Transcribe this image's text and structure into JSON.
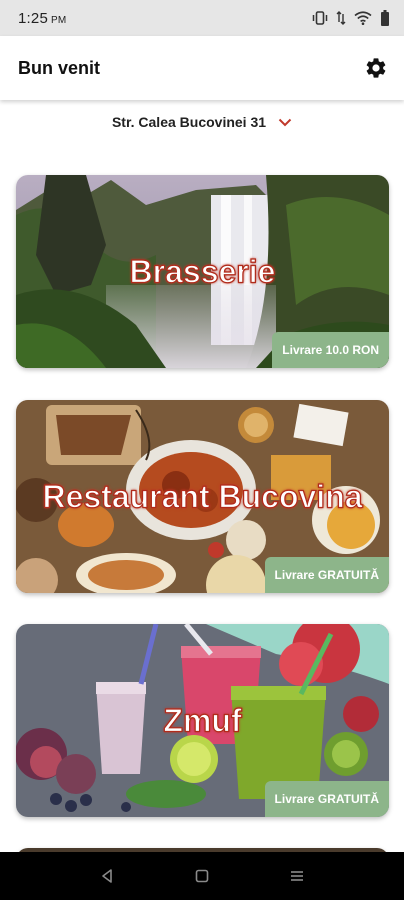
{
  "status_bar": {
    "time": "1:25",
    "ampm": "PM",
    "icons": [
      "vibrate-icon",
      "data-arrows-icon",
      "wifi-icon",
      "battery-icon"
    ]
  },
  "app_bar": {
    "title": "Bun venit",
    "settings_icon": "gear-icon"
  },
  "address": {
    "label": "Str. Calea Bucovinei 31",
    "icon": "chevron-down-icon",
    "accent": "#c0392b"
  },
  "restaurants": [
    {
      "name": "Brasserie",
      "delivery": "Livrare 10.0 RON"
    },
    {
      "name": "Restaurant Bucovina",
      "delivery": "Livrare GRATUITĂ"
    },
    {
      "name": "Zmuf",
      "delivery": "Livrare GRATUITĂ"
    }
  ],
  "colors": {
    "badge": "#8db58a",
    "title_stroke": "#c0392b",
    "status_bar": "#e6e6e6"
  },
  "nav_bar": {
    "buttons": [
      "back-icon",
      "home-icon",
      "recents-icon"
    ]
  }
}
